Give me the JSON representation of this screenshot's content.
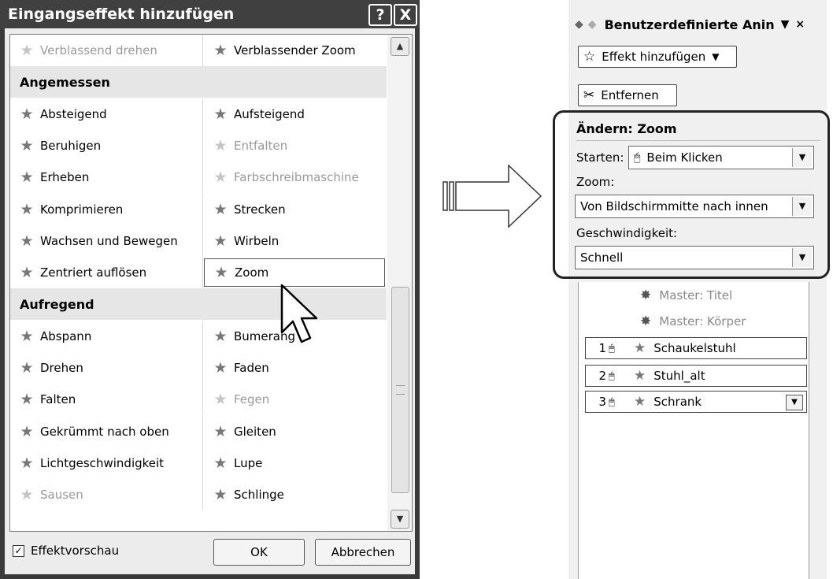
{
  "dialog": {
    "title": "Eingangseffekt hinzufügen",
    "help_label": "?",
    "close_label": "X",
    "rows": [
      {
        "type": "items",
        "left": {
          "label": "Verblassend drehen",
          "icon": "star-icon",
          "disabled": true
        },
        "right": {
          "label": "Verblassender Zoom",
          "icon": "star-icon",
          "disabled": false
        }
      },
      {
        "type": "header",
        "label": "Angemessen"
      },
      {
        "type": "items",
        "left": {
          "label": "Absteigend",
          "icon": "star-icon",
          "disabled": false
        },
        "right": {
          "label": "Aufsteigend",
          "icon": "star-icon",
          "disabled": false
        }
      },
      {
        "type": "items",
        "left": {
          "label": "Beruhigen",
          "icon": "star-icon",
          "disabled": false
        },
        "right": {
          "label": "Entfalten",
          "icon": "star-icon",
          "disabled": true
        }
      },
      {
        "type": "items",
        "left": {
          "label": "Erheben",
          "icon": "star-icon",
          "disabled": false
        },
        "right": {
          "label": "Farbschreibmaschine",
          "icon": "star-icon",
          "disabled": true
        }
      },
      {
        "type": "items",
        "left": {
          "label": "Komprimieren",
          "icon": "star-icon",
          "disabled": false
        },
        "right": {
          "label": "Strecken",
          "icon": "star-icon",
          "disabled": false
        }
      },
      {
        "type": "items",
        "left": {
          "label": "Wachsen und Bewegen",
          "icon": "star-icon",
          "disabled": false
        },
        "right": {
          "label": "Wirbeln",
          "icon": "star-icon",
          "disabled": false
        }
      },
      {
        "type": "items",
        "left": {
          "label": "Zentriert auflösen",
          "icon": "star-icon",
          "disabled": false
        },
        "right": {
          "label": "Zoom",
          "icon": "star-icon",
          "disabled": false,
          "selected": true
        }
      },
      {
        "type": "header",
        "label": "Aufregend"
      },
      {
        "type": "items",
        "left": {
          "label": "Abspann",
          "icon": "star-icon",
          "disabled": false
        },
        "right": {
          "label": "Bumerang",
          "icon": "star-icon",
          "disabled": false
        }
      },
      {
        "type": "items",
        "left": {
          "label": "Drehen",
          "icon": "star-icon",
          "disabled": false
        },
        "right": {
          "label": "Faden",
          "icon": "star-icon",
          "disabled": false
        }
      },
      {
        "type": "items",
        "left": {
          "label": "Falten",
          "icon": "star-icon",
          "disabled": false
        },
        "right": {
          "label": "Fegen",
          "icon": "star-icon",
          "disabled": true
        }
      },
      {
        "type": "items",
        "left": {
          "label": "Gekrümmt nach oben",
          "icon": "star-icon",
          "disabled": false
        },
        "right": {
          "label": "Gleiten",
          "icon": "star-icon",
          "disabled": false
        }
      },
      {
        "type": "items",
        "left": {
          "label": "Lichtgeschwindigkeit",
          "icon": "star-icon",
          "disabled": false
        },
        "right": {
          "label": "Lupe",
          "icon": "star-icon",
          "disabled": false
        }
      },
      {
        "type": "items",
        "left": {
          "label": "Sausen",
          "icon": "star-icon",
          "disabled": true
        },
        "right": {
          "label": "Schlinge",
          "icon": "star-icon",
          "disabled": false
        }
      }
    ],
    "preview_checkbox": {
      "label": "Effektvorschau",
      "checked": true
    },
    "ok_label": "OK",
    "cancel_label": "Abbrechen"
  },
  "pane": {
    "title": "Benutzerdefinierte Anin",
    "dropdown_glyph": "▼",
    "close_glyph": "×",
    "add_effect_label": "Effekt hinzufügen",
    "remove_label": "Entfernen",
    "change_heading": "Ändern: Zoom",
    "start_label": "Starten:",
    "start_value": "Beim Klicken",
    "zoom_label": "Zoom:",
    "zoom_value": "Von Bildschirmmitte nach innen",
    "speed_label": "Geschwindigkeit:",
    "speed_value": "Schnell",
    "master_items": [
      "Master: Titel",
      "Master: Körper"
    ],
    "effects": [
      {
        "num": "1",
        "name": "Schaukelstuhl"
      },
      {
        "num": "2",
        "name": "Stuhl_alt"
      },
      {
        "num": "3",
        "name": "Schrank"
      }
    ]
  }
}
